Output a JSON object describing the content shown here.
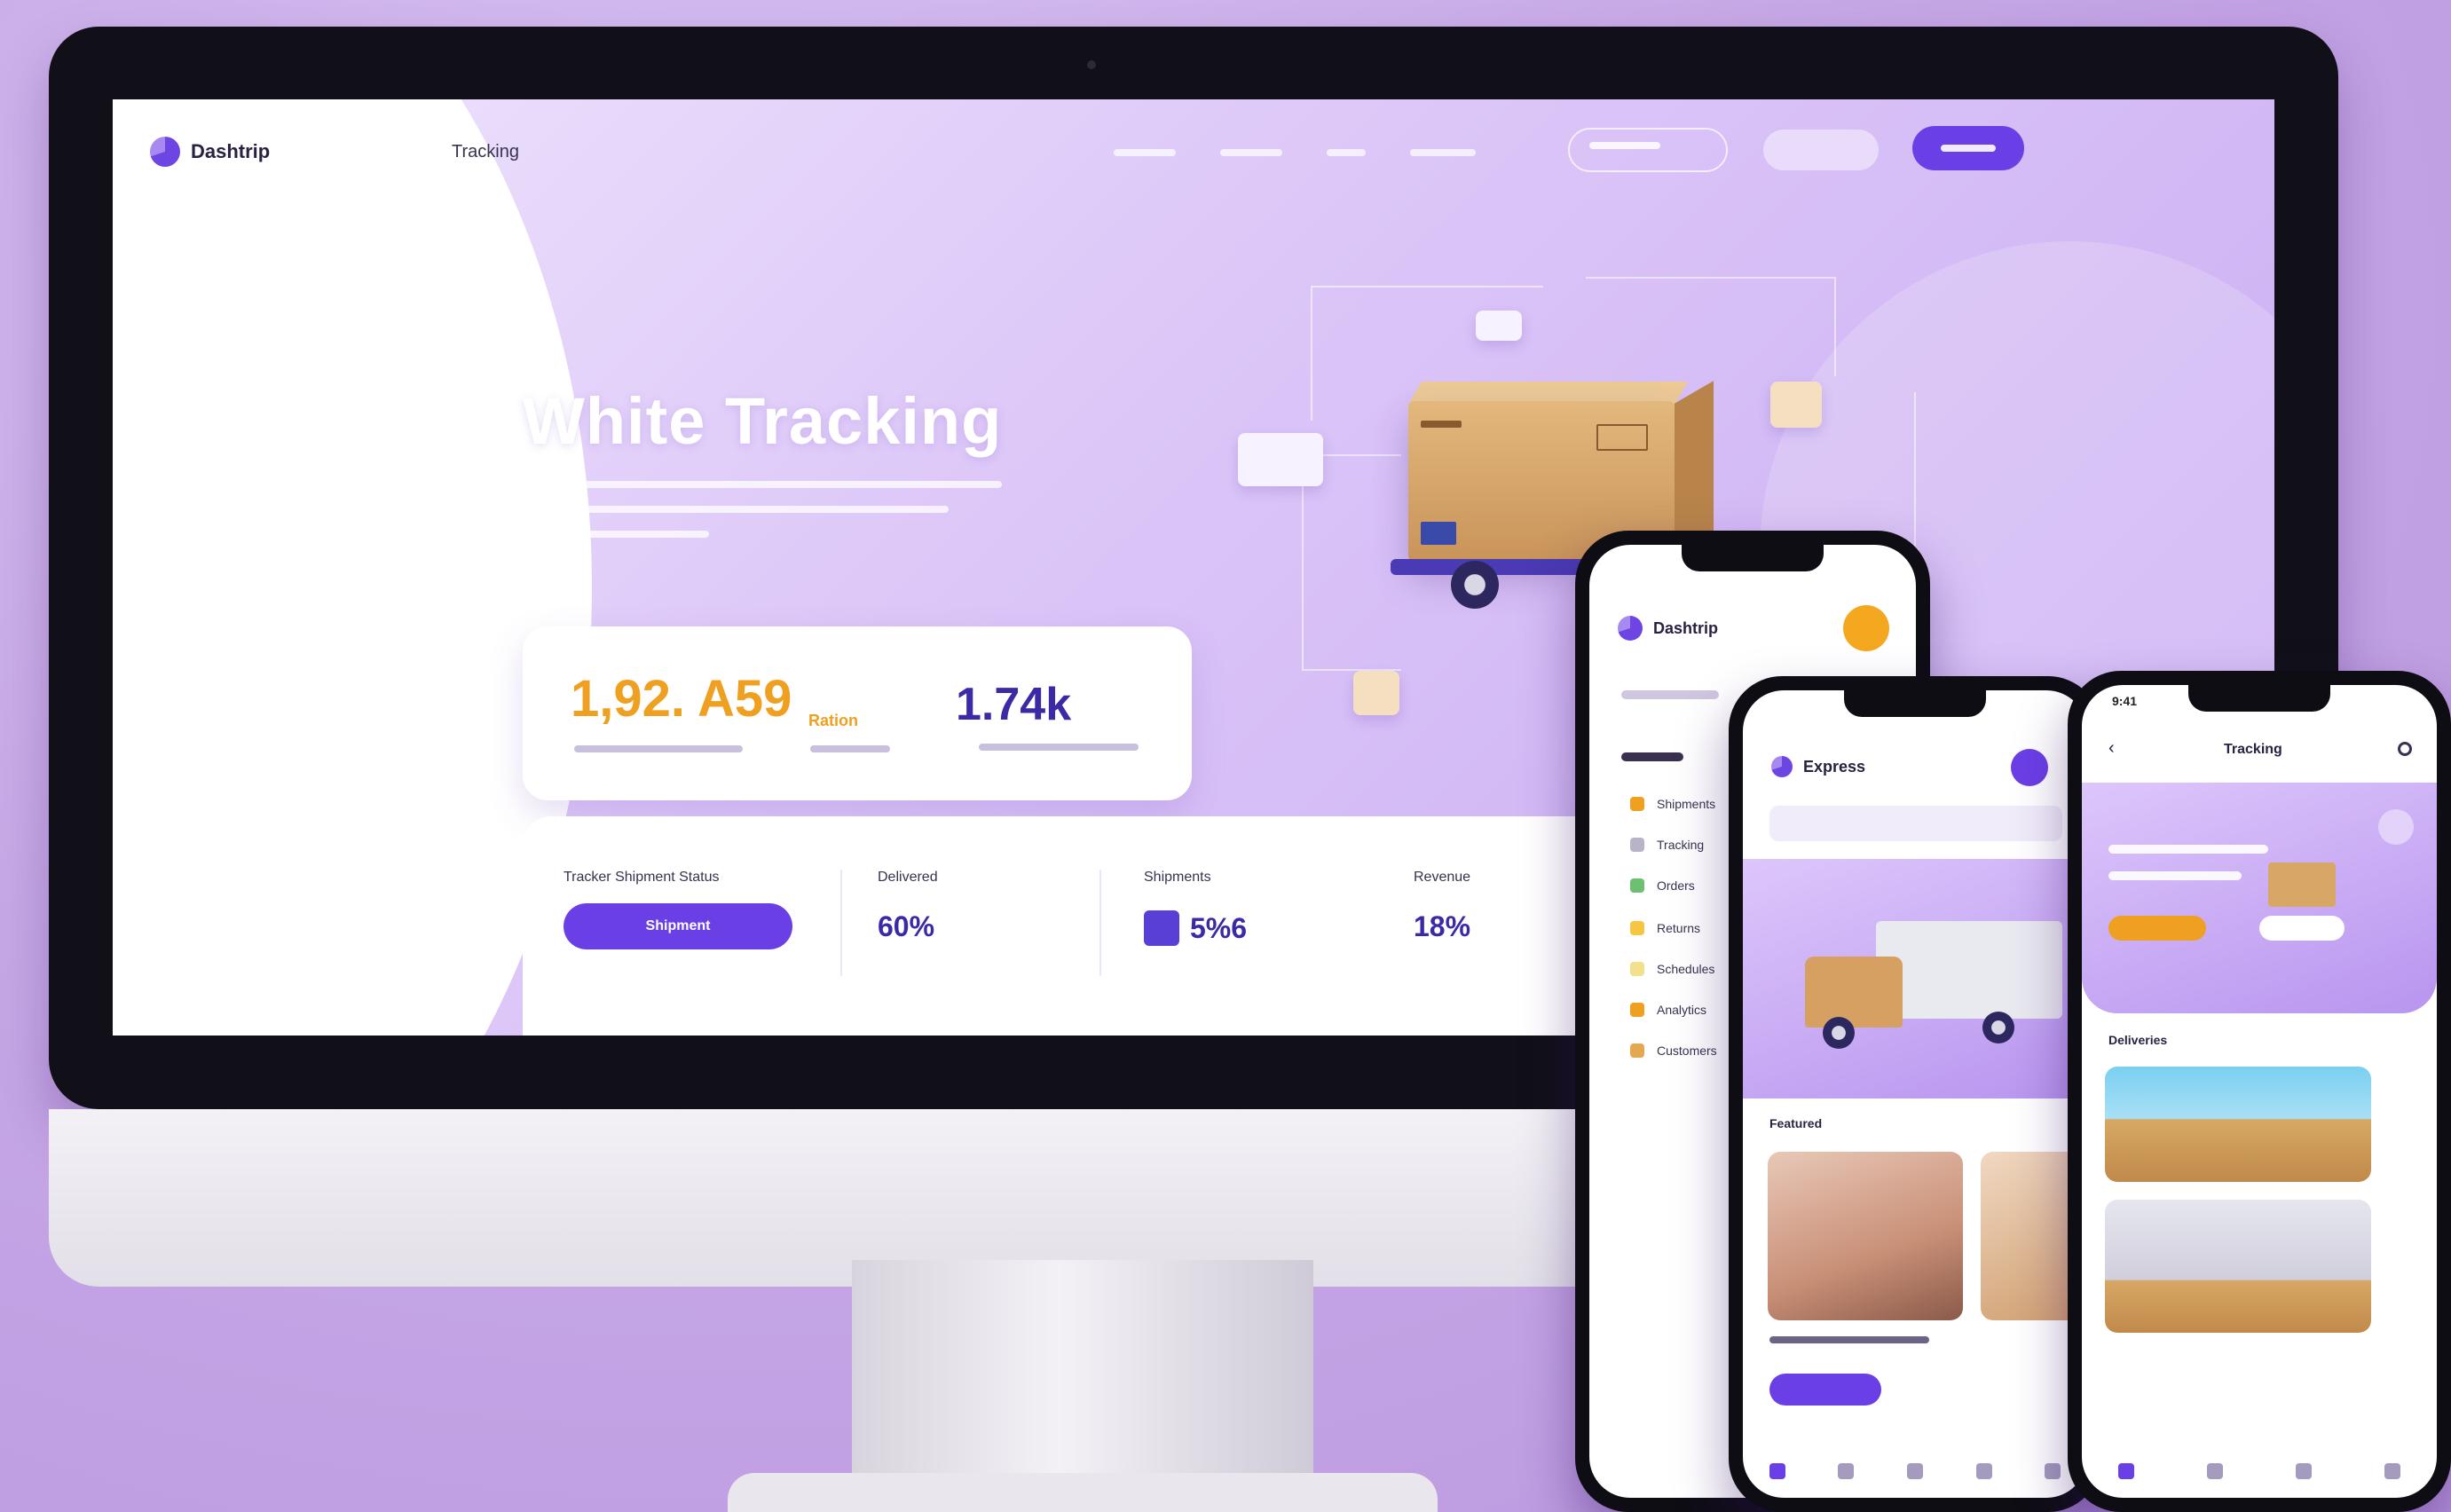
{
  "colors": {
    "accent": "#6b3fe6",
    "orange": "#f0a020",
    "navy": "#3b2aa6",
    "background": "#c9aee8"
  },
  "desktop": {
    "brand": "Dashtrip",
    "nav_tracking": "Tracking",
    "hero_title": "White Tracking",
    "stats": {
      "primary_value": "1,92. A59",
      "primary_suffix": "Ration",
      "secondary_value": "1.74k"
    },
    "panel": {
      "col1_label": "Tracker Shipment Status",
      "col1_button": "Shipment",
      "col2_label": "Delivered",
      "col2_value": "60%",
      "col3_label": "Shipments",
      "col3_value": "5%6",
      "col4_label": "Revenue",
      "col4_value": "18%"
    }
  },
  "phone1": {
    "title": "Dashtrip",
    "items": [
      "Shipments",
      "Tracking",
      "Orders",
      "Returns",
      "Schedules",
      "Analytics",
      "Customers"
    ]
  },
  "phone2": {
    "title": "Express",
    "section_label": "Featured"
  },
  "phone3": {
    "title": "Tracking",
    "section_label": "Deliveries",
    "time": "9:41"
  }
}
